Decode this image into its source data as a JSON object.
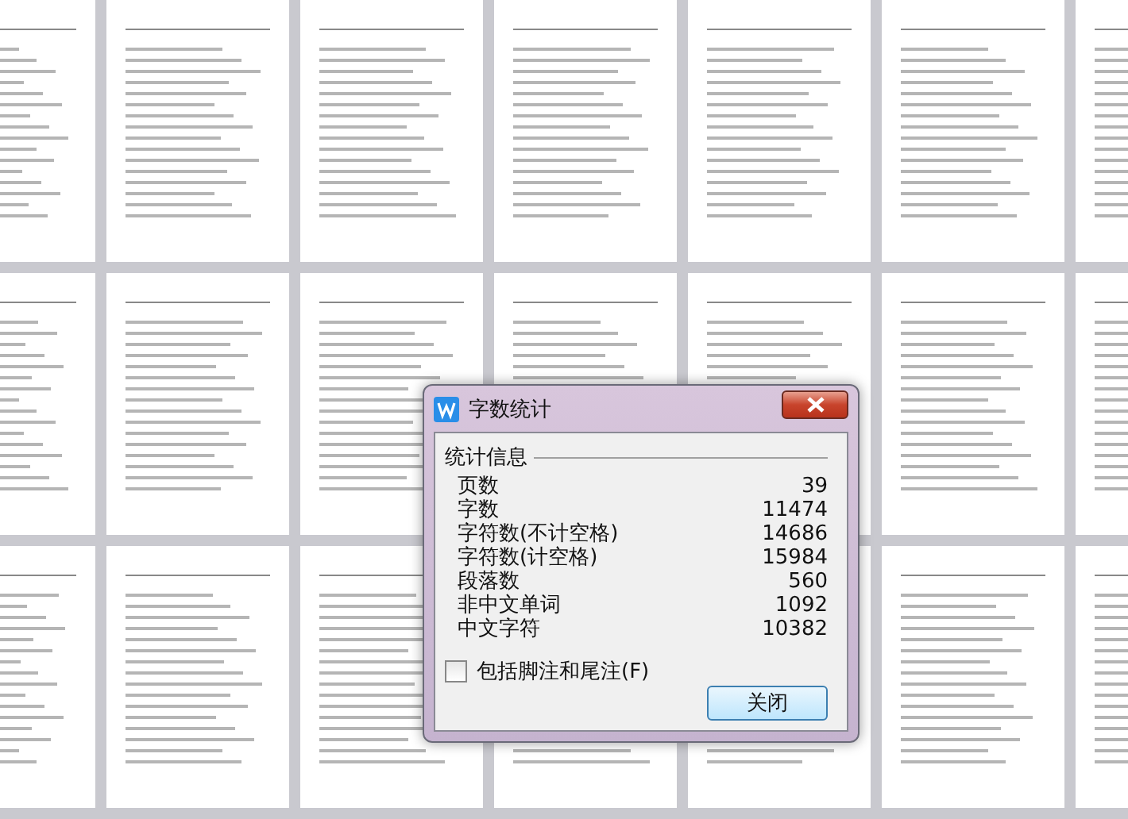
{
  "dialog": {
    "title": "字数统计",
    "group_label": "统计信息",
    "stats": [
      {
        "label": "页数",
        "value": "39"
      },
      {
        "label": "字数",
        "value": "11474"
      },
      {
        "label": "字符数(不计空格)",
        "value": "14686"
      },
      {
        "label": "字符数(计空格)",
        "value": "15984"
      },
      {
        "label": "段落数",
        "value": "560"
      },
      {
        "label": "非中文单词",
        "value": "1092"
      },
      {
        "label": "中文字符",
        "value": "10382"
      }
    ],
    "checkbox": {
      "label": "包括脚注和尾注(F)",
      "checked": false
    },
    "button": "关闭"
  }
}
